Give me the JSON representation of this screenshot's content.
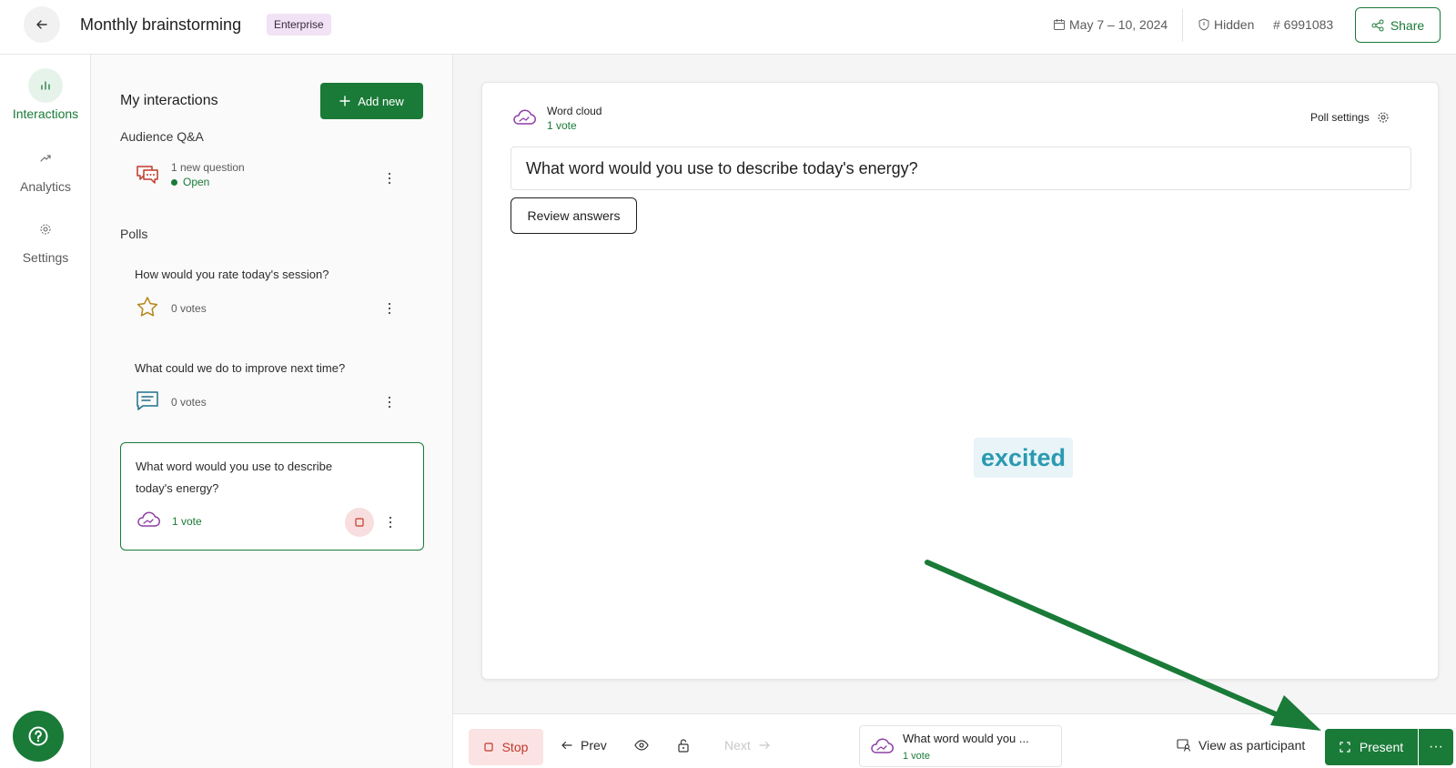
{
  "header": {
    "title": "Monthly brainstorming",
    "badge": "Enterprise",
    "date": "May 7 – 10, 2024",
    "visibility": "Hidden",
    "code": "# 6991083",
    "share_label": "Share"
  },
  "rail": {
    "items": [
      {
        "label": "Interactions",
        "icon": "bar-chart-icon"
      },
      {
        "label": "Analytics",
        "icon": "trend-icon"
      },
      {
        "label": "Settings",
        "icon": "gear-icon"
      }
    ]
  },
  "panel": {
    "title": "My interactions",
    "add_label": "Add new",
    "qa_section": "Audience Q&A",
    "qa_item": {
      "subtitle": "1 new question",
      "status": "Open"
    },
    "polls_section": "Polls",
    "polls": [
      {
        "question": "How would you rate today's session?",
        "votes": "0 votes",
        "icon": "star-icon"
      },
      {
        "question": "What could we do to improve next time?",
        "votes": "0 votes",
        "icon": "text-chat-icon"
      },
      {
        "question": "What word would you use to describe today's energy?",
        "votes": "1 vote",
        "icon": "word-cloud-icon"
      }
    ]
  },
  "card": {
    "type": "Word cloud",
    "votes": "1 vote",
    "poll_settings": "Poll settings",
    "question": "What word would you use to describe today's energy?",
    "review_label": "Review answers",
    "words": [
      "excited"
    ]
  },
  "bottombar": {
    "stop_label": "Stop",
    "prev_label": "Prev",
    "next_label": "Next",
    "current_title": "What word would you ...",
    "current_votes": "1 vote",
    "participant_label": "View as participant",
    "present_label": "Present",
    "more_label": "···"
  },
  "colors": {
    "brand_green": "#1a7a38",
    "word_cloud": "#2a9ab0",
    "stop_red": "#c0392b"
  }
}
